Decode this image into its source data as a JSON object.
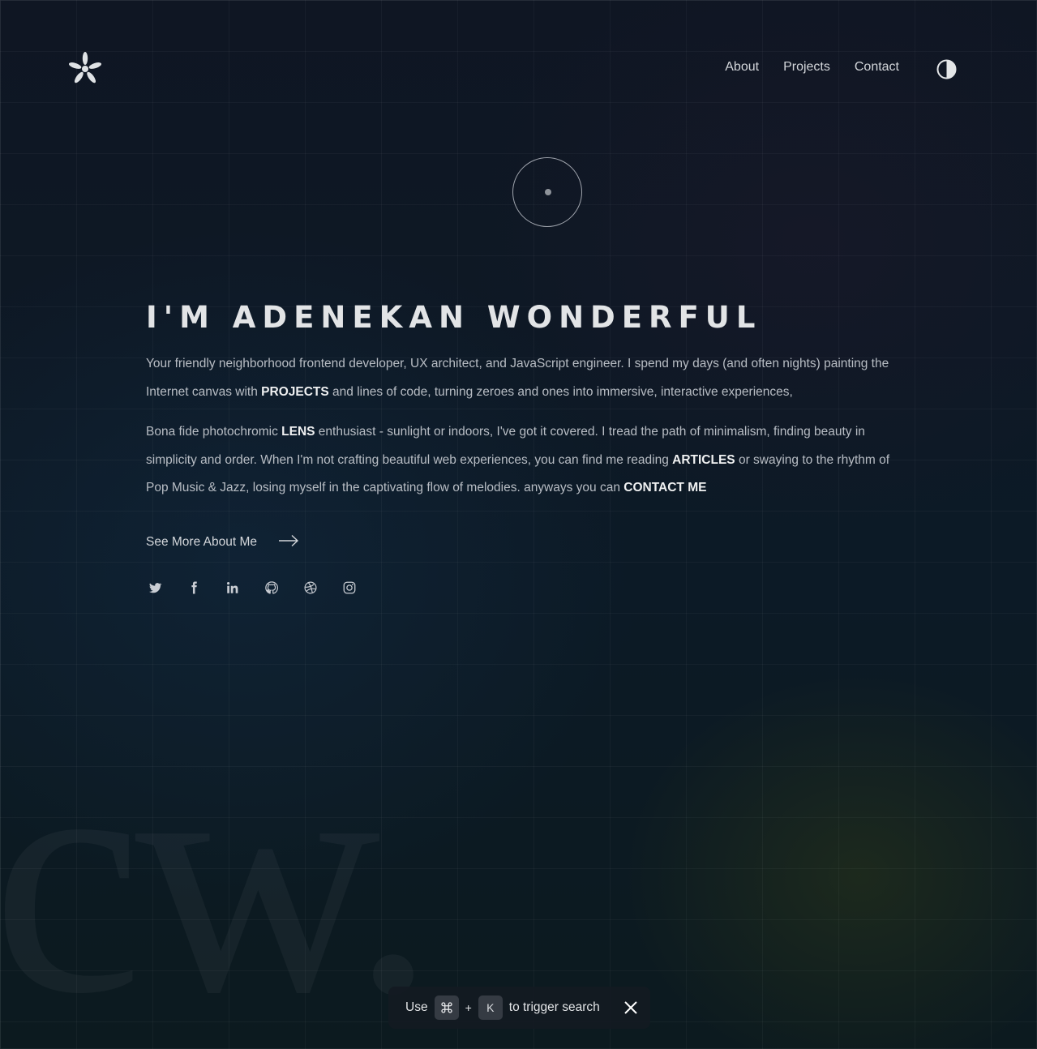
{
  "nav": {
    "items": [
      {
        "label": "About"
      },
      {
        "label": "Projects"
      },
      {
        "label": "Contact"
      }
    ],
    "logo_icon": "asterisk-icon",
    "theme_toggle_icon": "contrast-icon"
  },
  "avatar_icon": "avatar-ring-dot",
  "hero": {
    "title": "I'M ADENEKAN WONDERFUL",
    "bio1": {
      "t1": "Your friendly neighborhood frontend developer, UX architect, and JavaScript engineer. I spend my days (and often nights) painting the Internet canvas with ",
      "link": "PROJECTS",
      "t2": " and lines of code, turning zeroes and ones into immersive, interactive experiences,"
    },
    "bio2": {
      "t1": "Bona fide photochromic ",
      "link1": "LENS",
      "t2": " enthusiast - sunlight or indoors, I've got it covered. I tread the path of minimalism, finding beauty in simplicity and order. When I'm not crafting beautiful web experiences, you can find me reading ",
      "link2": "ARTICLES",
      "t3": " or swaying to the rhythm of Pop Music & Jazz, losing myself in the captivating flow of melodies. anyways you can ",
      "link3": "CONTACT ME"
    },
    "see_more": "See More About Me"
  },
  "socials": [
    "twitter-icon",
    "facebook-icon",
    "linkedin-icon",
    "github-icon",
    "dribbble-icon",
    "instagram-icon"
  ],
  "watermark": "cw.",
  "search_hint": {
    "use": "Use",
    "key1_icon": "command-key-icon",
    "plus": "+",
    "key2": "K",
    "tail": "to trigger search"
  },
  "colors": {
    "background": "#0d1420",
    "text": "#c9cdd3",
    "heading": "#e2e4e6",
    "accent_glow": "#3c4614"
  }
}
